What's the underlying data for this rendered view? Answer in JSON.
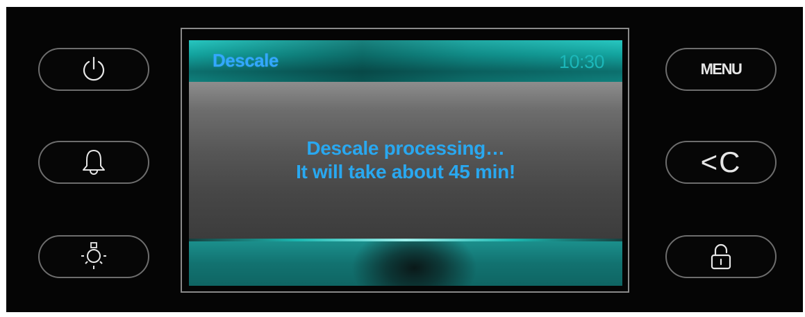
{
  "display": {
    "title": "Descale",
    "time": "10:30",
    "message_line1": "Descale processing…",
    "message_line2": "It will take about 45 min!"
  },
  "left_buttons": [
    {
      "name": "power-button",
      "icon": "power-icon"
    },
    {
      "name": "alarm-button",
      "icon": "bell-icon"
    },
    {
      "name": "light-button",
      "icon": "light-bulb-icon"
    }
  ],
  "right_buttons": {
    "menu_label": "MENU",
    "back_label": "<C",
    "lock_icon": "padlock-icon"
  },
  "colors": {
    "text_blue": "#29a8f0",
    "teal": "#13a39e",
    "panel": "#050505"
  }
}
